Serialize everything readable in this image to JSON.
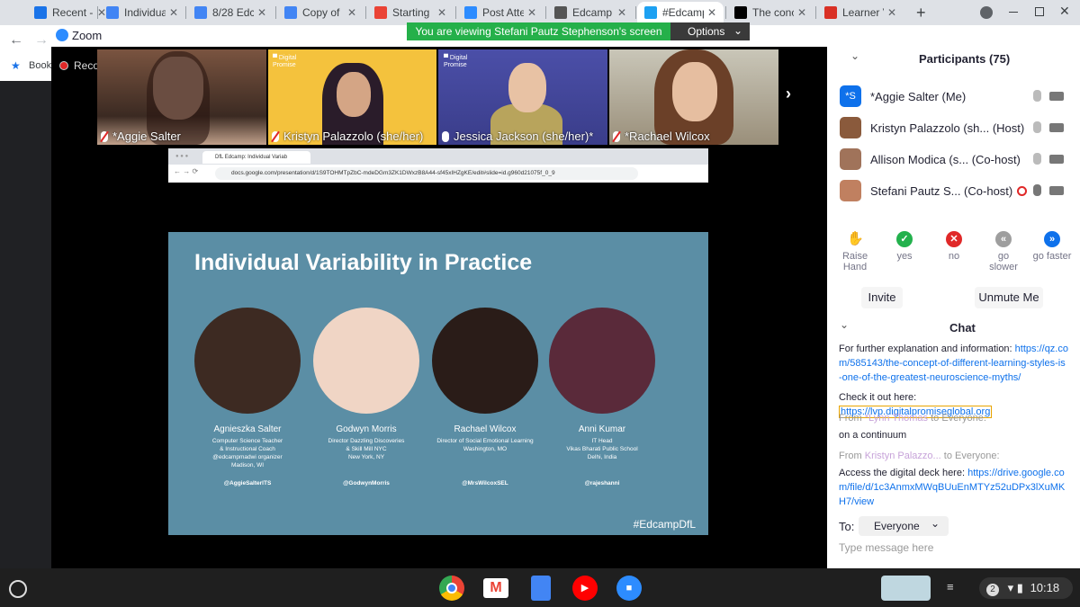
{
  "tabs": [
    {
      "label": "Recent - C",
      "icon": "google-drive-icon",
      "color": "#1a73e8"
    },
    {
      "label": "Individual",
      "icon": "google-docs-icon",
      "color": "#4285f4"
    },
    {
      "label": "8/28 Edc",
      "icon": "google-docs-icon",
      "color": "#4285f4"
    },
    {
      "label": "Copy of",
      "icon": "google-docs-icon",
      "color": "#4285f4"
    },
    {
      "label": "Starting",
      "icon": "gmail-icon",
      "color": "#ea4335"
    },
    {
      "label": "Post Atte",
      "icon": "zoom-icon",
      "color": "#2d8cff"
    },
    {
      "label": "Edcamp",
      "icon": "edcamp-icon",
      "color": "#555"
    },
    {
      "label": "#Edcamp",
      "icon": "twitter-icon",
      "color": "#1da1f2"
    },
    {
      "label": "The conc",
      "icon": "qz-icon",
      "color": "#000"
    },
    {
      "label": "Learner V",
      "icon": "bookmark-red-icon",
      "color": "#d93025"
    }
  ],
  "zoom": {
    "title": "Zoom",
    "banner": "You are viewing Stefani Pautz Stephenson's screen",
    "options": "Options",
    "recording": "Recording",
    "bookmarks_label": "Book"
  },
  "tiles": [
    {
      "name": "*Aggie Salter",
      "muted": true
    },
    {
      "name": "Kristyn Palazzolo (she/her)",
      "muted": true
    },
    {
      "name": "Jessica Jackson (she/her)*",
      "muted": false
    },
    {
      "name": "*Rachael Wilcox",
      "muted": true
    }
  ],
  "inner_browser": {
    "tab": "DfL Edcamp: Individual Variab",
    "url": "docs.google.com/presentation/d/1S9TOHMTpZbC-mdeDGm3ZK1DWxzB8A44-sf45xIHZgKE/edit#slide=id.g960d21075f_0_9"
  },
  "slide": {
    "title": "Individual Variability in Practice",
    "hashtag": "#EdcampDfL",
    "people": [
      {
        "name": "Agnieszka Salter",
        "lines": [
          "Computer Science Teacher",
          "& Instructional Coach",
          "@edcampmadwi organizer",
          "Madison, WI"
        ],
        "handle": "@AggieSalterITS"
      },
      {
        "name": "Godwyn Morris",
        "lines": [
          "Director Dazzling Discoveries",
          "& Skill Mill NYC",
          "New York, NY"
        ],
        "handle": "@GodwynMorris"
      },
      {
        "name": "Rachael Wilcox",
        "lines": [
          "Director of Social Emotional Learning",
          "Washington, MO"
        ],
        "handle": "@MrsWilcoxSEL"
      },
      {
        "name": "Anni Kumar",
        "lines": [
          "IT Head",
          "Vikas Bharati Public School",
          "Delhi, India"
        ],
        "handle": "@rajeshanni"
      }
    ]
  },
  "participants": {
    "header": "Participants (75)",
    "list": [
      {
        "name": "*Aggie Salter (Me)",
        "avatar": "*S",
        "color": "#0e71eb"
      },
      {
        "name": "Kristyn Palazzolo (sh... (Host)",
        "avatar": "",
        "color": "#8a5a3c"
      },
      {
        "name": "Allison Modica (s... (Co-host)",
        "avatar": "",
        "color": "#a0735a"
      },
      {
        "name": "Stefani Pautz S... (Co-host)",
        "avatar": "",
        "color": "#c08060"
      }
    ]
  },
  "reactions": [
    {
      "label": "Raise\nHand",
      "l1": "Raise",
      "l2": "Hand",
      "color": "#0e71eb",
      "icon": "raise-hand-icon"
    },
    {
      "l1": "yes",
      "l2": "",
      "color": "#23b14d",
      "icon": "check-icon"
    },
    {
      "l1": "no",
      "l2": "",
      "color": "#e02828",
      "icon": "x-icon"
    },
    {
      "l1": "go",
      "l2": "slower",
      "color": "#9e9e9e",
      "icon": "rewind-icon"
    },
    {
      "l1": "go faster",
      "l2": "",
      "color": "#0e71eb",
      "icon": "fast-forward-icon"
    }
  ],
  "actions": {
    "invite": "Invite",
    "unmute": "Unmute Me"
  },
  "chat": {
    "header": "Chat",
    "m1_text": "For further explanation and information: ",
    "m1_link": "https://qz.com/585143/the-concept-of-different-learning-styles-is-one-of-the-greatest-neuroscience-myths/",
    "m2_text": "Check it out here: ",
    "m2_link": "https://lvp.digitalpromiseglobal.org",
    "m3_from": "From ",
    "m3_sender": "*Lynn Thomas",
    "m3_to": " to ",
    "m3_dest": "Everyone:",
    "m3_text": "on a continuum",
    "m4_from": "From ",
    "m4_sender": "Kristyn Palazzo...",
    "m4_to": " to ",
    "m4_dest": "Everyone:",
    "m4_text": "Access the digital deck here: ",
    "m4_link": "https://drive.google.com/file/d/1c3AnmxMWqBUuEnMTYz52uDPx3lXuMKH7/view",
    "to_label": "To:",
    "to_value": "Everyone",
    "placeholder": "Type message here"
  },
  "shelf": {
    "time": "10:18",
    "badge": "2"
  }
}
